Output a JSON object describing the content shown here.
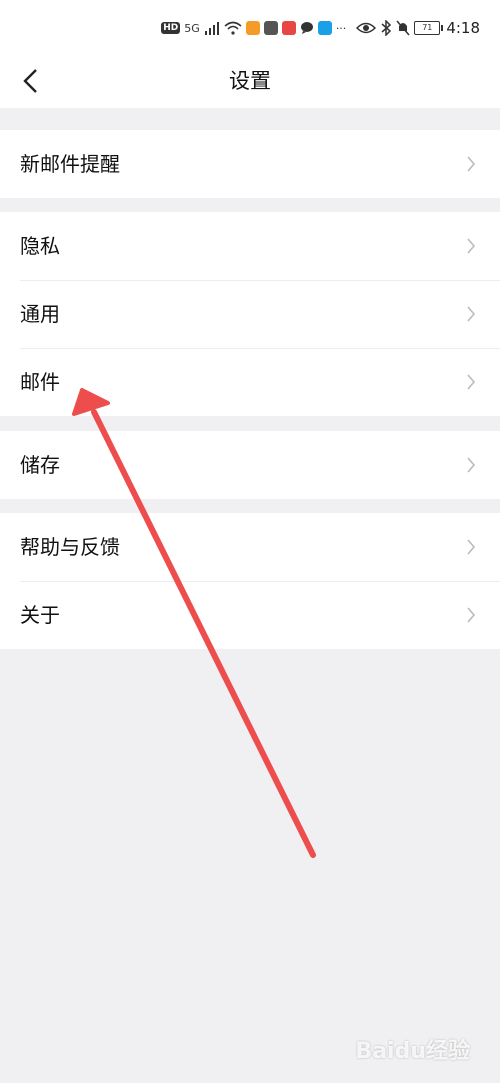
{
  "status_bar": {
    "hd_badge": "HD",
    "network": "5G",
    "battery": "71",
    "time": "4:18",
    "dots": "···"
  },
  "header": {
    "title": "设置"
  },
  "groups": [
    {
      "items": [
        {
          "label": "新邮件提醒"
        }
      ]
    },
    {
      "items": [
        {
          "label": "隐私"
        },
        {
          "label": "通用"
        },
        {
          "label": "邮件"
        }
      ]
    },
    {
      "items": [
        {
          "label": "储存"
        }
      ]
    },
    {
      "items": [
        {
          "label": "帮助与反馈"
        },
        {
          "label": "关于"
        }
      ]
    }
  ],
  "annotation": {
    "color": "#ee4d4d"
  },
  "watermark": "Baidu经验"
}
